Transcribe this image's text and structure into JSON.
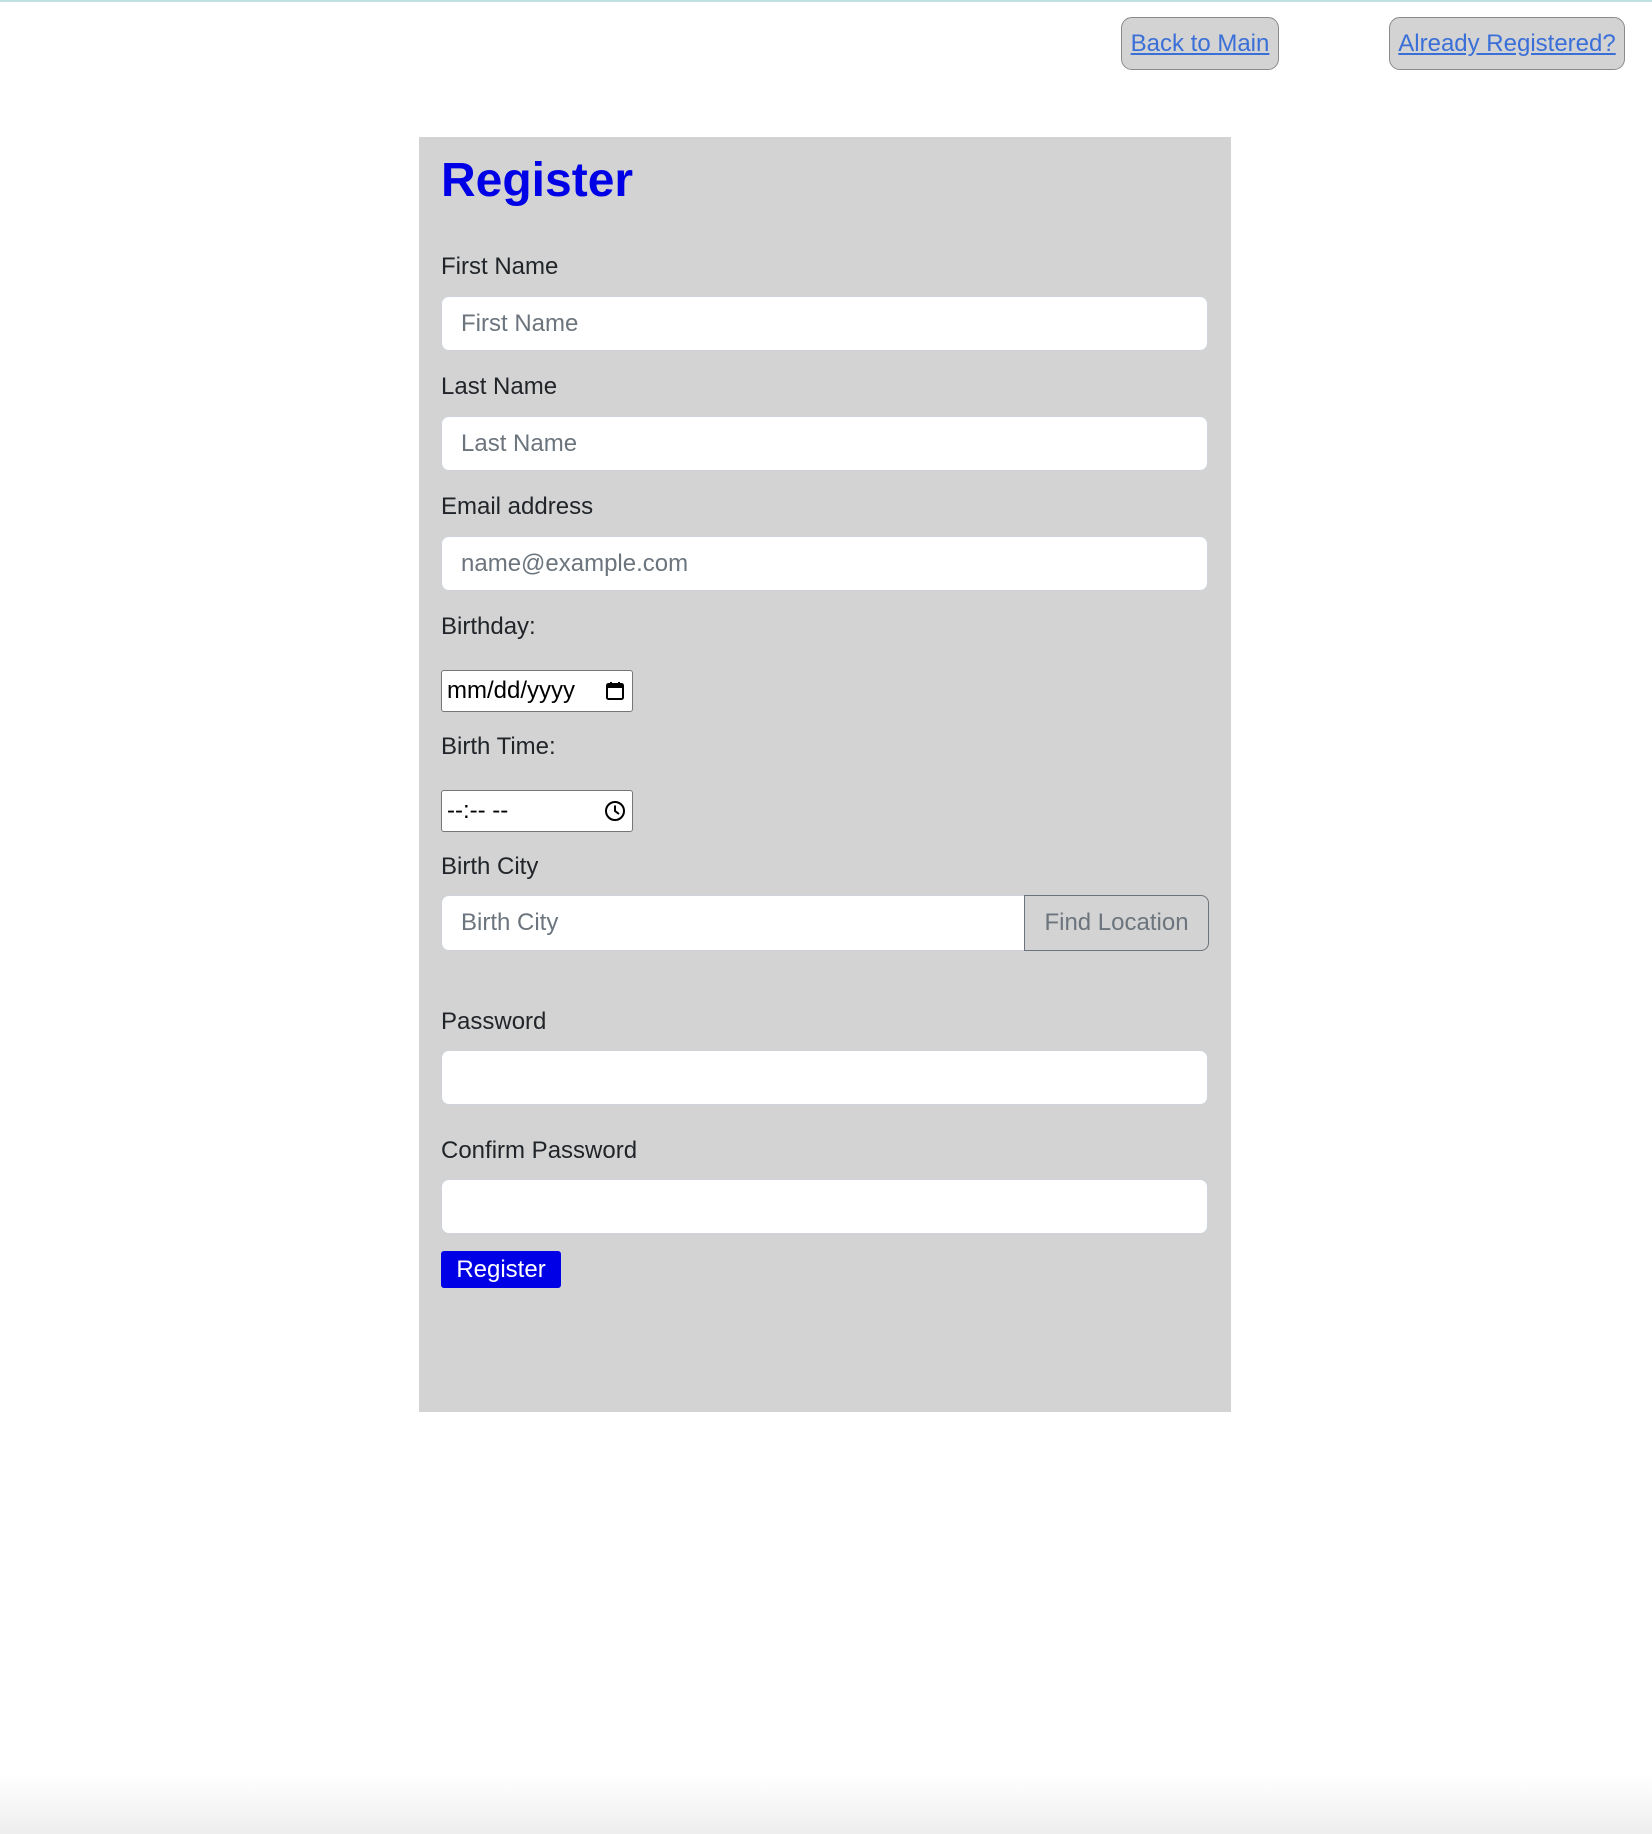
{
  "nav": {
    "back_label": "Back to Main",
    "already_label": "Already Registered?"
  },
  "form": {
    "title": "Register",
    "first_name": {
      "label": "First Name",
      "placeholder": "First Name",
      "value": ""
    },
    "last_name": {
      "label": "Last Name",
      "placeholder": "Last Name",
      "value": ""
    },
    "email": {
      "label": "Email address",
      "placeholder": "name@example.com",
      "value": ""
    },
    "birthday": {
      "label": "Birthday:",
      "display": "mm/dd/yyyy",
      "icon": "calendar-icon"
    },
    "birth_time": {
      "label": "Birth Time:",
      "display": "--:-- --",
      "icon": "clock-icon"
    },
    "birth_city": {
      "label": "Birth City",
      "placeholder": "Birth City",
      "value": "",
      "button_label": "Find Location"
    },
    "password": {
      "label": "Password",
      "value": ""
    },
    "confirm_password": {
      "label": "Confirm Password",
      "value": ""
    },
    "submit_label": "Register"
  },
  "colors": {
    "title": "#0000e6",
    "submit_bg": "#0000e6",
    "panel_bg": "#d3d3d3",
    "link": "#3a6fd8"
  }
}
